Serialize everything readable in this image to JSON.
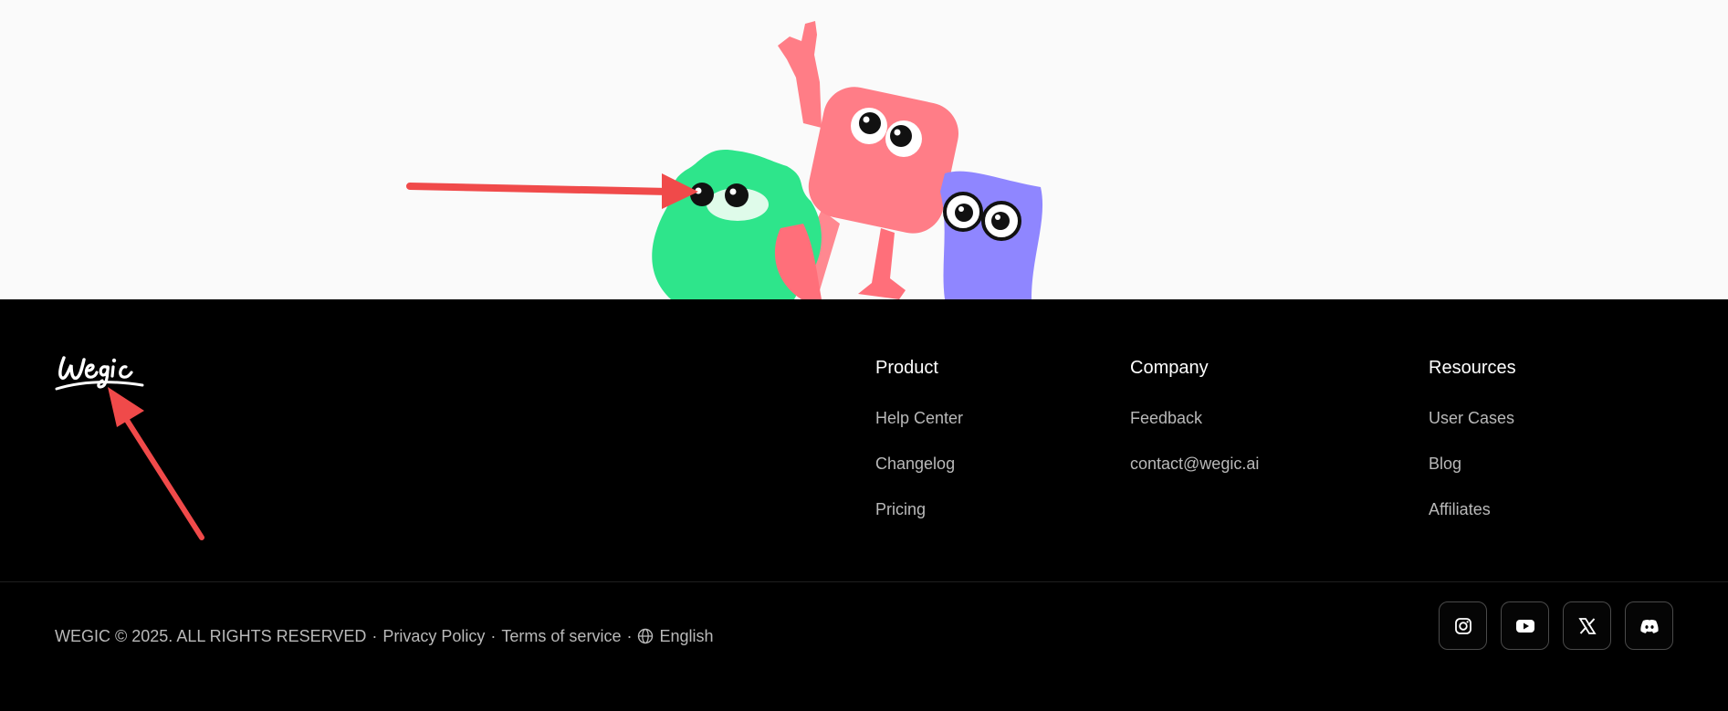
{
  "hero": {
    "illustration": "three-mascot-characters",
    "annotation_color": "#f04a4a"
  },
  "brand": {
    "logo_text": "Wegic",
    "logo_icon": "wegic-script-logo"
  },
  "footer": {
    "columns": [
      {
        "title": "Product",
        "links": [
          "Help Center",
          "Changelog",
          "Pricing"
        ]
      },
      {
        "title": "Company",
        "links": [
          "Feedback",
          "contact@wegic.ai"
        ]
      },
      {
        "title": "Resources",
        "links": [
          "User Cases",
          "Blog",
          "Affiliates"
        ]
      }
    ],
    "copyright": "WEGIC © 2025. ALL RIGHTS RESERVED",
    "separator": "·",
    "privacy": "Privacy Policy",
    "terms": "Terms of service",
    "language": "English",
    "socials": [
      "instagram-icon",
      "youtube-icon",
      "x-icon",
      "discord-icon"
    ]
  },
  "colors": {
    "footer_bg": "#000000",
    "link": "#b9b9b9",
    "heading": "#ffffff"
  }
}
